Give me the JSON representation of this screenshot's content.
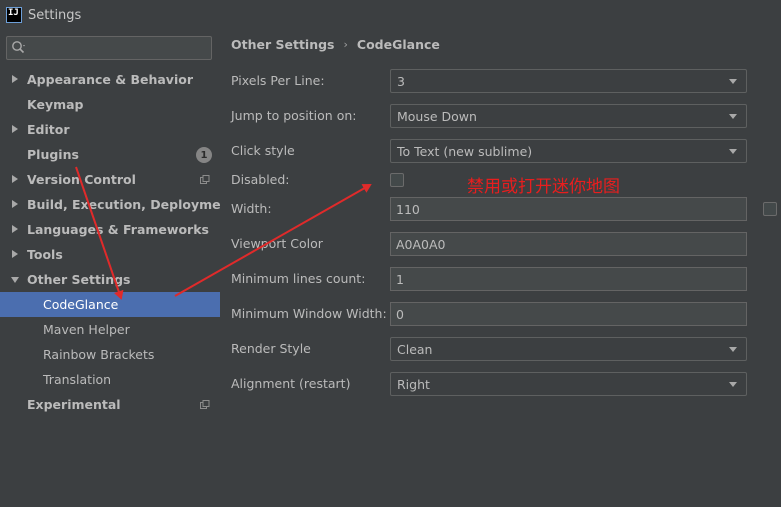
{
  "window": {
    "title": "Settings",
    "app_icon_text": "IJ"
  },
  "search": {
    "placeholder": "",
    "value": ""
  },
  "tree": [
    {
      "label": "Appearance & Behavior",
      "expandable": true,
      "expanded": false
    },
    {
      "label": "Keymap",
      "expandable": false
    },
    {
      "label": "Editor",
      "expandable": true,
      "expanded": false
    },
    {
      "label": "Plugins",
      "expandable": false,
      "badge": "1"
    },
    {
      "label": "Version Control",
      "expandable": true,
      "expanded": false,
      "icon": "copy-icon"
    },
    {
      "label": "Build, Execution, Deployment",
      "expandable": true,
      "expanded": false
    },
    {
      "label": "Languages & Frameworks",
      "expandable": true,
      "expanded": false
    },
    {
      "label": "Tools",
      "expandable": true,
      "expanded": false
    },
    {
      "label": "Other Settings",
      "expandable": true,
      "expanded": true
    },
    {
      "label": "CodeGlance",
      "child": true,
      "selected": true
    },
    {
      "label": "Maven Helper",
      "child": true
    },
    {
      "label": "Rainbow Brackets",
      "child": true
    },
    {
      "label": "Translation",
      "child": true
    },
    {
      "label": "Experimental",
      "expandable": false,
      "icon": "copy-icon"
    }
  ],
  "breadcrumb": {
    "parent": "Other Settings",
    "separator": "›",
    "current": "CodeGlance"
  },
  "settings": {
    "pixels_per_line": {
      "label": "Pixels Per Line:",
      "value": "3"
    },
    "jump_to_position": {
      "label": "Jump to position on:",
      "value": "Mouse Down"
    },
    "click_style": {
      "label": "Click style",
      "value": "To Text (new sublime)"
    },
    "disabled": {
      "label": "Disabled:",
      "checked": false
    },
    "width": {
      "label": "Width:",
      "value": "110",
      "checked": false
    },
    "viewport_color": {
      "label": "Viewport Color",
      "value": "A0A0A0"
    },
    "min_lines_count": {
      "label": "Minimum lines count:",
      "value": "1"
    },
    "min_window_width": {
      "label": "Minimum Window Width:",
      "value": "0"
    },
    "render_style": {
      "label": "Render Style",
      "value": "Clean"
    },
    "alignment": {
      "label": "Alignment (restart)",
      "value": "Right"
    }
  },
  "annotation": {
    "text": "禁用或打开迷你地图",
    "color": "#e81e1e"
  },
  "colors": {
    "background": "#3c3f41",
    "selection": "#4b6eaf",
    "arrow": "#e02a2a"
  }
}
